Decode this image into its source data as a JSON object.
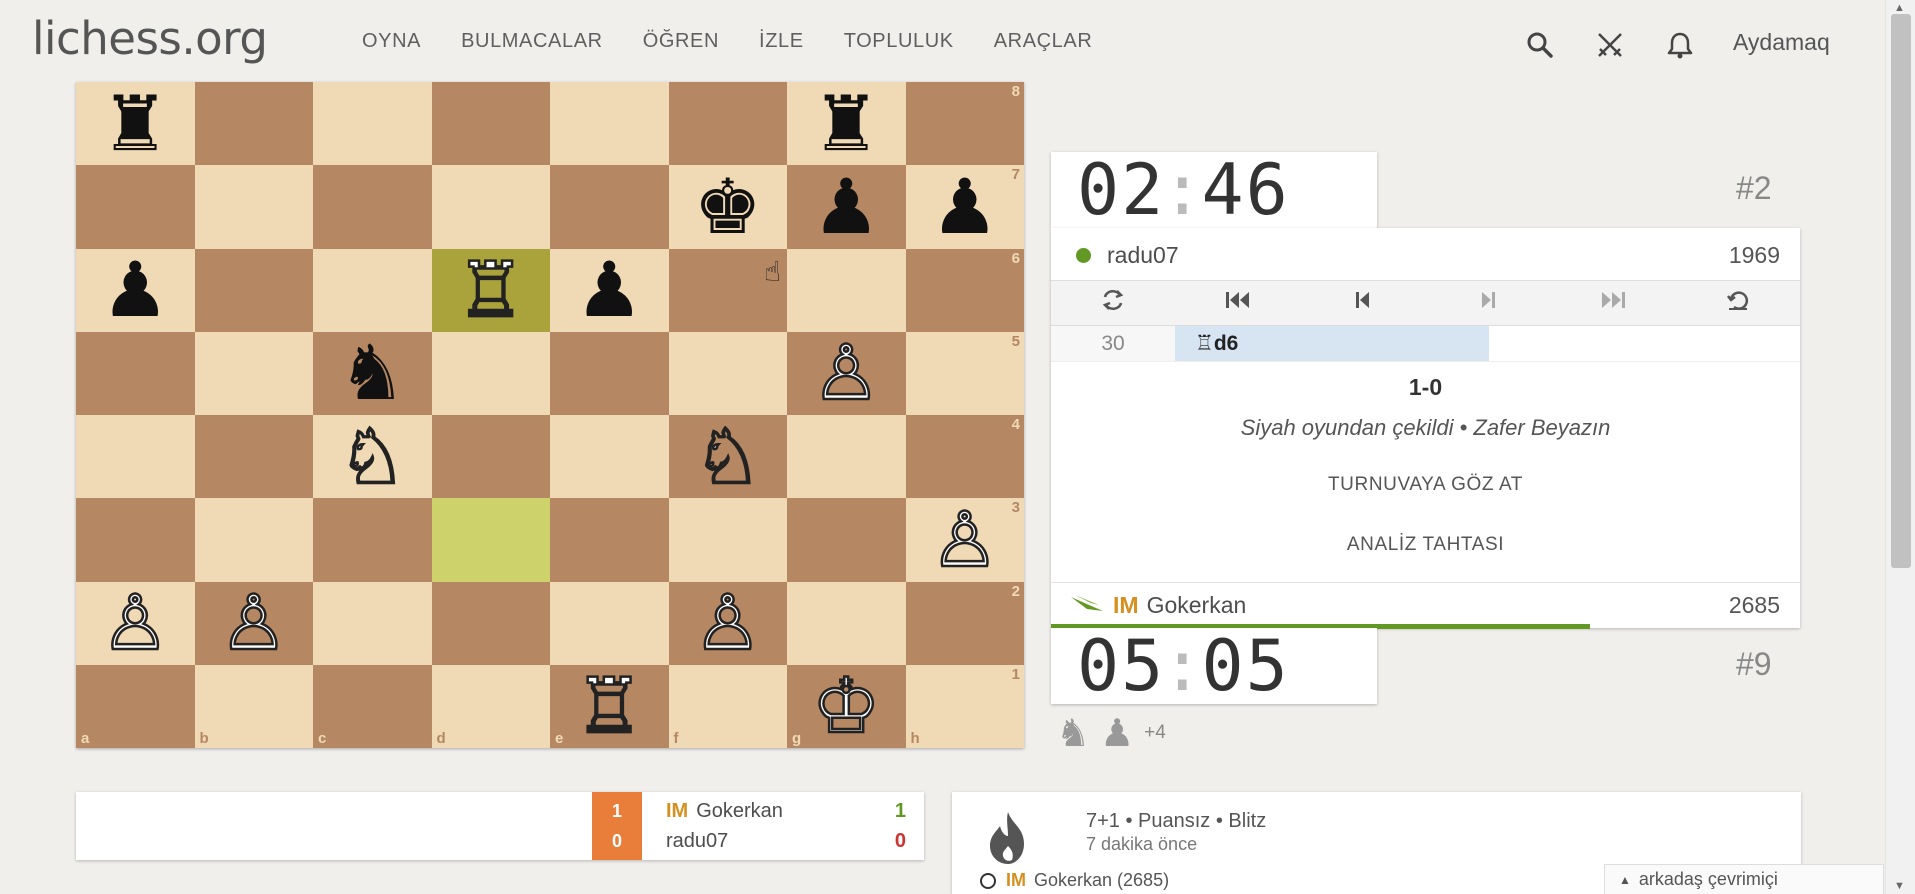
{
  "header": {
    "logo": "lichess.org",
    "nav": [
      "OYNA",
      "BULMACALAR",
      "ÖĞREN",
      "İZLE",
      "TOPLULUK",
      "ARAÇLAR"
    ],
    "username": "Aydamaq",
    "icons": [
      "search-icon",
      "swords-icon",
      "bell-icon"
    ]
  },
  "board": {
    "ranks": [
      "8",
      "7",
      "6",
      "5",
      "4",
      "3",
      "2",
      "1"
    ],
    "files": [
      "a",
      "b",
      "c",
      "d",
      "e",
      "f",
      "g",
      "h"
    ],
    "squares": [
      [
        "♜",
        "",
        "",
        "",
        "",
        "",
        "♜",
        ""
      ],
      [
        "",
        "",
        "",
        "",
        "",
        "♚",
        "♟",
        "♟"
      ],
      [
        "♟",
        "",
        "",
        "♖",
        "♟",
        "",
        "",
        ""
      ],
      [
        "",
        "",
        "♞",
        "",
        "",
        "",
        "♙",
        ""
      ],
      [
        "",
        "",
        "♘",
        "",
        "",
        "♘",
        "",
        ""
      ],
      [
        "",
        "",
        "",
        "",
        "",
        "",
        "",
        "♙"
      ],
      [
        "♙",
        "♙",
        "",
        "",
        "",
        "♙",
        "",
        ""
      ],
      [
        "",
        "",
        "",
        "",
        "♖",
        "",
        "♔",
        ""
      ]
    ],
    "last_move_from": "d3",
    "last_move_to": "d6",
    "colors": {
      "light": "#f0d9b5",
      "dark": "#b58863"
    }
  },
  "top_clock": {
    "minutes": "02",
    "seconds": "46",
    "rank_tag": "#2",
    "bar_fraction": 0.91
  },
  "bottom_clock": {
    "minutes": "05",
    "seconds": "05",
    "rank_tag": "#9",
    "bar_fraction": 0.72
  },
  "top_player": {
    "name": "radu07",
    "rating": "1969"
  },
  "bottom_player": {
    "title": "IM",
    "name": "Gokerkan",
    "rating": "2685"
  },
  "controls": [
    "flip-board-icon",
    "first-move-icon",
    "prev-move-icon",
    "next-move-icon",
    "last-move-icon",
    "analysis-toggle-icon"
  ],
  "moves": {
    "number": "30",
    "san": "♖d6"
  },
  "result": {
    "score": "1-0",
    "status": "Siyah oyundan çekildi • Zafer Beyazın",
    "view_tournament": "TURNUVAYA GÖZ AT",
    "analysis_board": "ANALİZ TAHTASI"
  },
  "material": {
    "pieces": [
      "♞",
      "♟"
    ],
    "diff": "+4"
  },
  "crosstable": {
    "scores": [
      "1",
      "0"
    ],
    "rows": [
      {
        "title": "IM",
        "name": "Gokerkan",
        "points": "1"
      },
      {
        "title": "",
        "name": "radu07",
        "points": "0"
      }
    ]
  },
  "game_info": {
    "setup": "7+1 • Puansız • Blitz",
    "time_ago": "7 dakika önce",
    "player_title": "IM",
    "player": "Gokerkan (2685)"
  },
  "friends_bar": "arkadaş çevrimiçi",
  "accent_colors": {
    "green": "#629924",
    "orange": "#e87e3a",
    "title": "#d59020"
  }
}
